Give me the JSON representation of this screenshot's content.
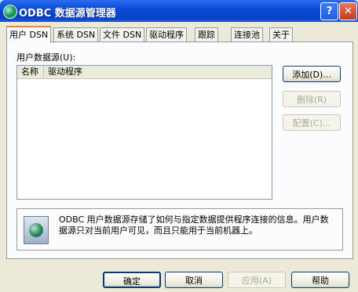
{
  "window": {
    "title": "ODBC 数据源管理器",
    "help_glyph": "?",
    "close_glyph": "✕"
  },
  "tabs": [
    {
      "label": "用户 DSN",
      "active": true
    },
    {
      "label": "系统 DSN"
    },
    {
      "label": "文件 DSN"
    },
    {
      "label": "驱动程序"
    },
    {
      "label": "跟踪"
    },
    {
      "label": "连接池"
    },
    {
      "label": "关于"
    }
  ],
  "user_dsn": {
    "list_label": "用户数据源(U):",
    "columns": [
      "名称",
      "驱动程序"
    ],
    "rows": [],
    "buttons": {
      "add": "添加(D)...",
      "remove": "删除(R)",
      "configure": "配置(C)..."
    },
    "info": "ODBC 用户数据源存储了如何与指定数据提供程序连接的信息。用户数据源只对当前用户可见，而且只能用于当前机器上。"
  },
  "footer": {
    "ok": "确定",
    "cancel": "取消",
    "apply": "应用(A)",
    "help": "帮助"
  },
  "colors": {
    "titlebar": "#0a4bd8",
    "dialog_bg": "#ece9d8",
    "active_tab_accent": "#e68b2c"
  }
}
